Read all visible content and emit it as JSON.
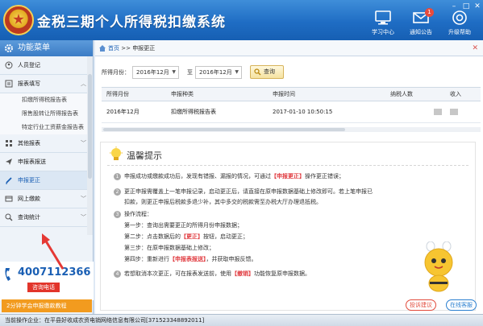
{
  "header": {
    "title": "金税三期个人所得税扣缴系统",
    "buttons": [
      {
        "label": "学习中心",
        "icon": "computer-icon"
      },
      {
        "label": "通知公告",
        "icon": "mail-icon",
        "badge": "1"
      },
      {
        "label": "升级帮助",
        "icon": "help-icon"
      }
    ]
  },
  "sidebar": {
    "title": "功能菜单",
    "items": [
      {
        "label": "人员登记",
        "icon": "person-icon"
      },
      {
        "label": "报表填写",
        "icon": "form-icon"
      },
      {
        "label": "扣缴所得税报告表"
      },
      {
        "label": "限售股转让所得报告表"
      },
      {
        "label": "特定行业工资薪金报告表"
      },
      {
        "label": "其他报表",
        "icon": "grid-icon"
      },
      {
        "label": "申报表报送",
        "icon": "send-icon"
      },
      {
        "label": "申报更正",
        "icon": "edit-icon"
      },
      {
        "label": "网上缴款",
        "icon": "pay-icon"
      },
      {
        "label": "查询统计",
        "icon": "search-icon"
      }
    ],
    "phone": "4007112366",
    "phone_label": "咨询电话",
    "banner": "2分钟学会申报缴款教程"
  },
  "breadcrumb": {
    "home": "首页",
    "sep": ">>",
    "current": "申报更正"
  },
  "filter": {
    "label": "所得月份：",
    "from": "2016年12月",
    "to_label": "至",
    "to": "2016年12月",
    "query": "查询"
  },
  "table": {
    "headers": [
      "所得月份",
      "申报种类",
      "申报时间",
      "纳税人数",
      "收入"
    ],
    "rows": [
      {
        "month": "2016年12月",
        "type": "扣缴所得税报告表",
        "time": "2017-01-10 10:50:15"
      }
    ]
  },
  "tips": {
    "title": "温馨提示",
    "t1a": "申报成功或缴款成功后，发现有错报、漏报的情况，可通过",
    "t1b": "【申报更正】",
    "t1c": "操作更正错误；",
    "t2a": "更正申报需覆盖上一笔申报记录，启动更正后，请直接在原申报数据基础上修改即可。若上笔申报已",
    "t2b": "扣款，则更正申报后税款多退少补，其中多交的税款需至办税大厅办理退抵税。",
    "t3": "操作流程：",
    "s1": "第一步：查询出需要更正的所得月份申报数据；",
    "s2a": "第二步：点击数据后的",
    "s2b": "【更正】",
    "s2c": "按钮，启动更正；",
    "s3": "第三步：在原申报数据基础上修改；",
    "s4a": "第四步：重新进行",
    "s4b": "【申报表报送】",
    "s4c": "，并获取申报反馈。",
    "t4a": "若想取消本次更正，可在报表发送前，使用",
    "t4b": "【撤销】",
    "t4c": "功能恢复原申报数据。"
  },
  "bottom": {
    "suggest": "投诉建议",
    "online": "在线客服"
  },
  "status": "当前操作企业：在平县好收成农资电销网络信息有限公司[371523348892011]",
  "colors": {
    "header": "#1f6dc4",
    "accent": "#1a5fb4",
    "red": "#e0393e"
  }
}
